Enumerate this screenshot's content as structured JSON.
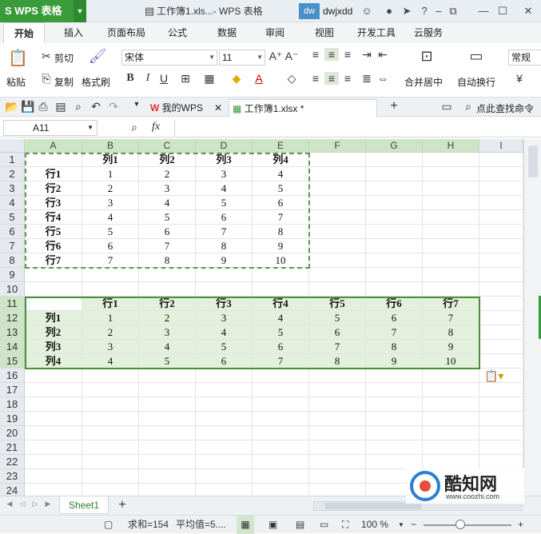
{
  "titlebar": {
    "app_name": "WPS 表格",
    "doc_title": "工作簿1.xls...- WPS 表格",
    "badge": "dw",
    "username": "dwjxdd",
    "help": "?"
  },
  "menu_tabs": [
    "开始",
    "插入",
    "页面布局",
    "公式",
    "数据",
    "审阅",
    "视图",
    "开发工具",
    "云服务"
  ],
  "ribbon": {
    "paste": "粘贴",
    "cut": "剪切",
    "copy": "复制",
    "format_painter": "格式刷",
    "font_name": "宋体",
    "font_size": "11",
    "merge": "合并居中",
    "wrap": "自动换行",
    "number_format": "常规"
  },
  "doc_tabs": {
    "tab1": "我的WPS",
    "tab2": "工作簿1.xlsx *",
    "search": "点此查找命令"
  },
  "formula": {
    "cell_ref": "A11",
    "fx": "fx"
  },
  "columns": [
    "A",
    "B",
    "C",
    "D",
    "E",
    "F",
    "G",
    "H",
    "I"
  ],
  "rows": [
    "1",
    "2",
    "3",
    "4",
    "5",
    "6",
    "7",
    "8",
    "9",
    "10",
    "11",
    "12",
    "13",
    "14",
    "15",
    "16",
    "17",
    "18",
    "19",
    "20",
    "21",
    "22",
    "23",
    "24"
  ],
  "table1": {
    "header": [
      "",
      "列1",
      "列2",
      "列3",
      "列4"
    ],
    "body": [
      [
        "行1",
        "1",
        "2",
        "3",
        "4"
      ],
      [
        "行2",
        "2",
        "3",
        "4",
        "5"
      ],
      [
        "行3",
        "3",
        "4",
        "5",
        "6"
      ],
      [
        "行4",
        "4",
        "5",
        "6",
        "7"
      ],
      [
        "行5",
        "5",
        "6",
        "7",
        "8"
      ],
      [
        "行6",
        "6",
        "7",
        "8",
        "9"
      ],
      [
        "行7",
        "7",
        "8",
        "9",
        "10"
      ]
    ]
  },
  "table2": {
    "header": [
      "",
      "行1",
      "行2",
      "行3",
      "行4",
      "行5",
      "行6",
      "行7"
    ],
    "body": [
      [
        "列1",
        "1",
        "2",
        "3",
        "4",
        "5",
        "6",
        "7"
      ],
      [
        "列2",
        "2",
        "3",
        "4",
        "5",
        "6",
        "7",
        "8"
      ],
      [
        "列3",
        "3",
        "4",
        "5",
        "6",
        "7",
        "8",
        "9"
      ],
      [
        "列4",
        "4",
        "5",
        "6",
        "7",
        "8",
        "9",
        "10"
      ]
    ]
  },
  "sheet_tab": "Sheet1",
  "status": {
    "sum": "求和=154",
    "avg": "平均值=5....",
    "zoom": "100 %"
  },
  "watermark": {
    "name": "酷知网",
    "url": "www.coozhi.com"
  },
  "colors": {
    "brand_green": "#3a9b3a",
    "selection": "#4c8f3c",
    "highlight": "#e3f1dc"
  }
}
